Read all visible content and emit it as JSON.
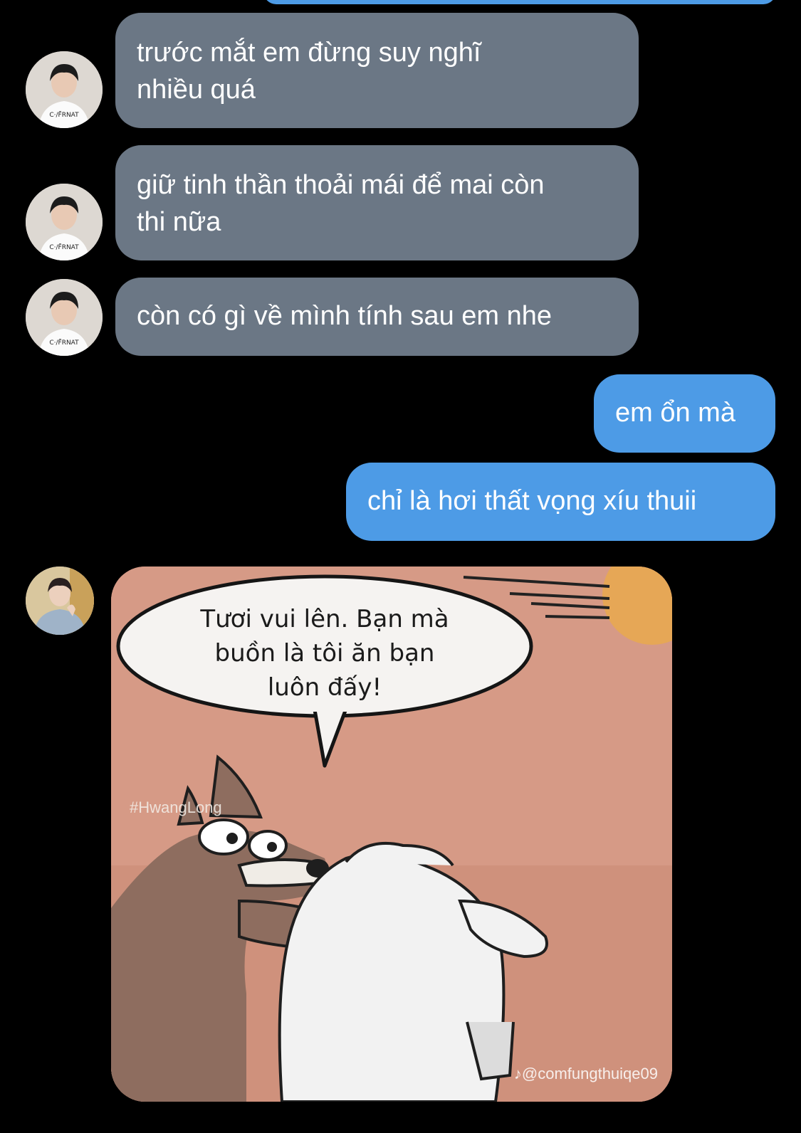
{
  "messages": [
    {
      "sender": "them",
      "lines": [
        "trước mắt em đừng suy nghĩ",
        "nhiều quá"
      ]
    },
    {
      "sender": "them",
      "lines": [
        "giữ tinh thần thoải mái để mai còn",
        "thi nữa"
      ]
    },
    {
      "sender": "them",
      "lines": [
        "còn có gì về mình tính sau em nhe"
      ]
    },
    {
      "sender": "me",
      "lines": [
        "em ổn mà"
      ]
    },
    {
      "sender": "me",
      "lines": [
        "chỉ là hơi thất vọng xíu thuii"
      ]
    }
  ],
  "meme": {
    "speech_lines": [
      "Tươi vui lên. Bạn mà",
      "buồn là tôi ăn bạn",
      "luôn đấy!"
    ],
    "hashtag": "#HwangLong",
    "watermark": "♪@comfungthuiqe09",
    "colors": {
      "background": "#d39682",
      "wolf": "#8e6d5f",
      "sheep": "#f2f2f2"
    }
  },
  "colors": {
    "incoming_bubble": "#6b7785",
    "outgoing_bubble": "#4d9be6",
    "background": "#000000"
  }
}
